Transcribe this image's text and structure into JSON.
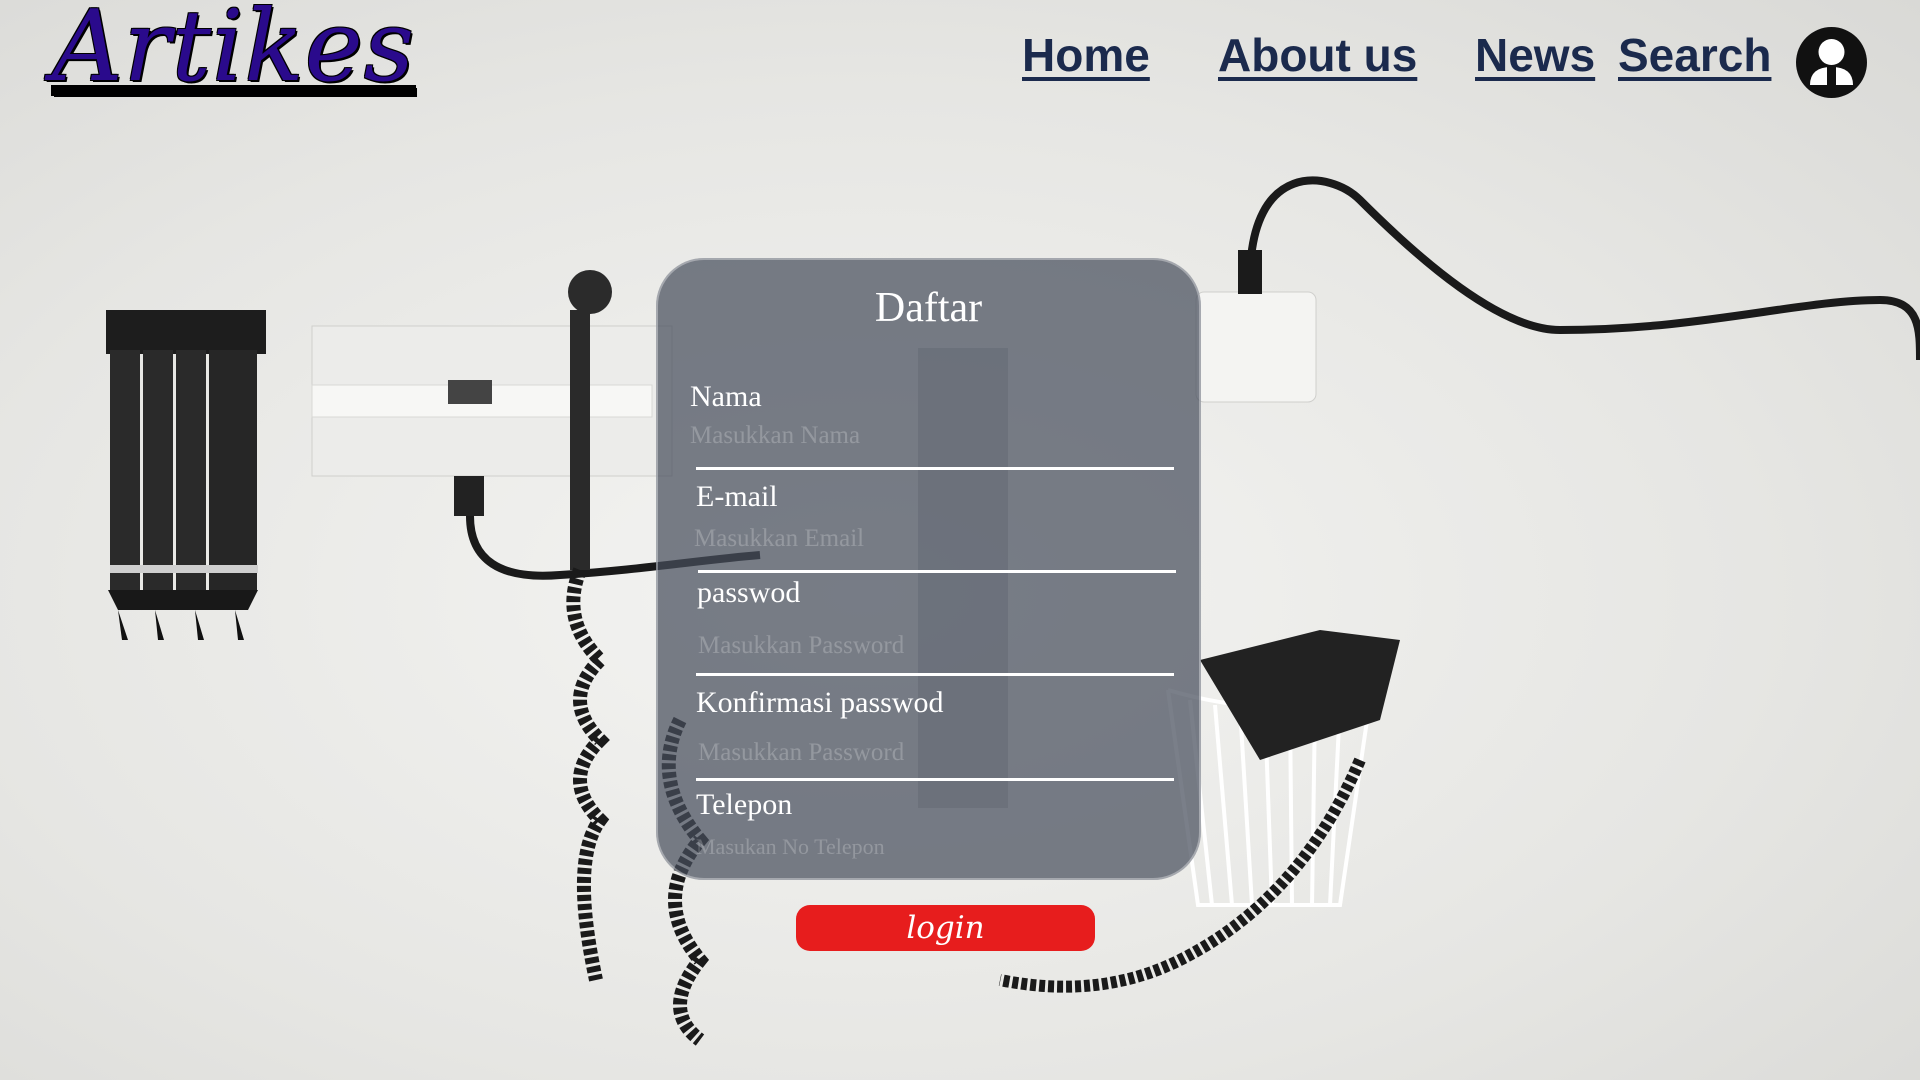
{
  "header": {
    "logo": "Artikes",
    "nav": {
      "home": "Home",
      "about": "About us ",
      "news": "News",
      "search": "Search"
    },
    "profile_icon": "user-avatar-icon"
  },
  "form": {
    "title": "Daftar",
    "fields": {
      "nama": {
        "label": "Nama",
        "placeholder": "Masukkan Nama"
      },
      "email": {
        "label": "E-mail",
        "placeholder": "Masukkan Email"
      },
      "password": {
        "label": "passwod",
        "placeholder": "Masukkan Password"
      },
      "confirm": {
        "label": "Konfirmasi passwod",
        "placeholder": "Masukkan Password"
      },
      "telepon": {
        "label": "Telepon",
        "placeholder": "Masukan No Telepon"
      }
    },
    "submit_label": "login"
  },
  "colors": {
    "logo": "#2a0a8c",
    "nav": "#1b2a4d",
    "card": "#464e5c",
    "button": "#e71d1d"
  }
}
